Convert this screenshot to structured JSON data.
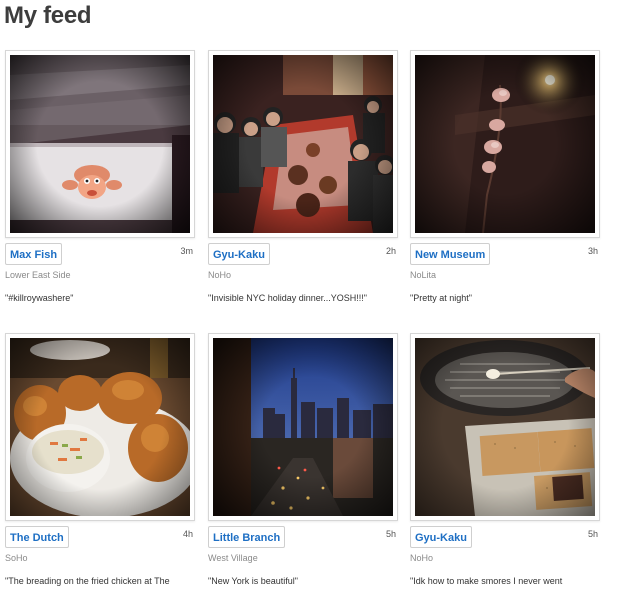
{
  "header": {
    "title": "My feed"
  },
  "feed": [
    {
      "venue": "Max Fish",
      "time": "3m",
      "neighborhood": "Lower East Side",
      "comment": "\"#killroywashere\"",
      "photo_icon": "sticker-photo"
    },
    {
      "venue": "Gyu-Kaku",
      "time": "2h",
      "neighborhood": "NoHo",
      "comment": "\"Invisible NYC holiday dinner...YOSH!!!\"",
      "photo_icon": "group-dinner-photo"
    },
    {
      "venue": "New Museum",
      "time": "3h",
      "neighborhood": "NoLita",
      "comment": "\"Pretty at night\"",
      "photo_icon": "night-flower-photo"
    },
    {
      "venue": "The Dutch",
      "time": "4h",
      "neighborhood": "SoHo",
      "comment": "\"The breading on the fried chicken at The",
      "photo_icon": "fried-chicken-photo"
    },
    {
      "venue": "Little Branch",
      "time": "5h",
      "neighborhood": "West Village",
      "comment": "\"New York is beautiful\"",
      "photo_icon": "city-skyline-photo"
    },
    {
      "venue": "Gyu-Kaku",
      "time": "5h",
      "neighborhood": "NoHo",
      "comment": "\"Idk how to make smores I never went",
      "photo_icon": "smores-photo"
    }
  ]
}
